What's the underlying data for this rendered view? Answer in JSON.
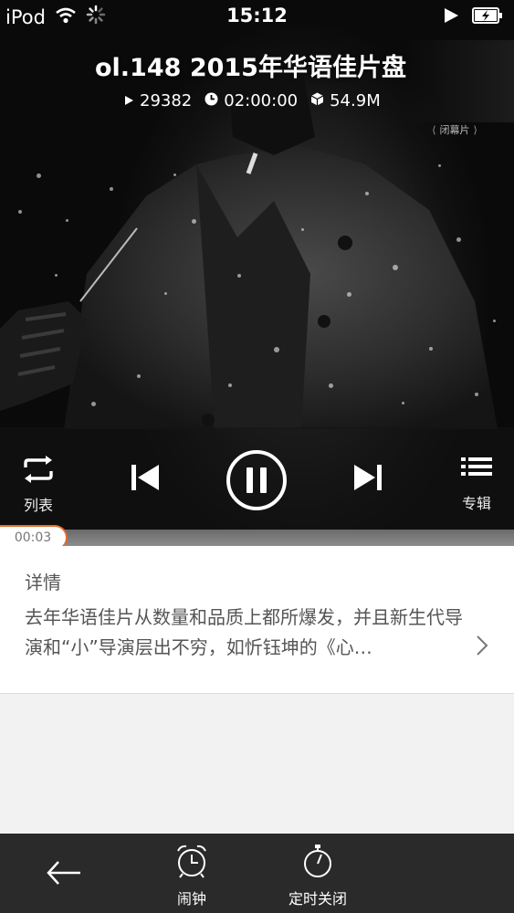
{
  "status_bar": {
    "carrier": "iPod",
    "time": "15:12",
    "icons": [
      "wifi-icon",
      "activity-spinner-icon",
      "play-status-icon",
      "battery-charging-icon"
    ]
  },
  "episode": {
    "title": "ol.148 2015年华语佳片盘",
    "plays": "29382",
    "duration": "02:00:00",
    "size": "54.9M",
    "artwork_badge": "闭幕片"
  },
  "controls": {
    "list_label": "列表",
    "album_label": "专辑",
    "icons": [
      "repeat-icon",
      "previous-icon",
      "pause-icon",
      "next-icon",
      "album-list-icon"
    ]
  },
  "progress": {
    "elapsed": "00:03"
  },
  "details": {
    "heading": "详情",
    "text": "去年华语佳片从数量和品质上都所爆发，并且新生代导演和“小”导演层出不穷，如忻钰坤的《心…"
  },
  "bottom_bar": {
    "alarm_label": "闹钟",
    "sleep_timer_label": "定时关闭",
    "icons": [
      "back-arrow-icon",
      "alarm-clock-icon",
      "timer-icon"
    ]
  },
  "colors": {
    "accent": "#e36a2b",
    "bottom_bar": "#2a2a2a",
    "panel_bg": "#f2f2f2"
  }
}
